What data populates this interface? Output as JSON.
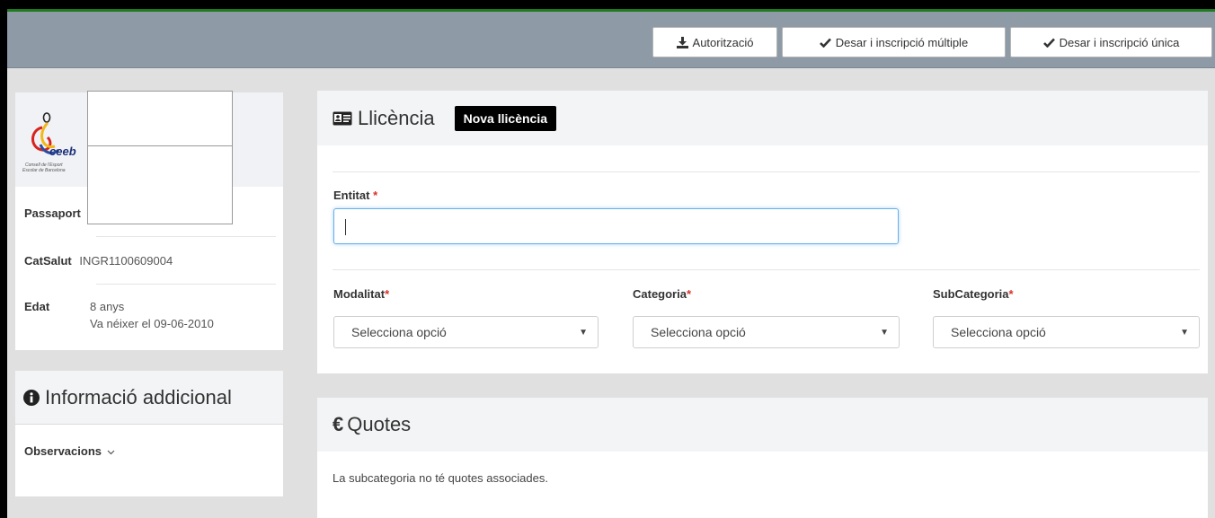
{
  "toolbar": {
    "authorization_label": "Autorització",
    "save_multiple_label": "Desar i inscripció múltiple",
    "save_single_label": "Desar i inscripció única"
  },
  "profile": {
    "logo_text": "ceeb",
    "logo_subtitle": "Consell de l'Esport Escolar de Barcelona",
    "passport_label": "Passaport",
    "catsalut_label": "CatSalut",
    "catsalut_value": "INGR1100609004",
    "age_label": "Edat",
    "age_value": "8 anys",
    "birth_text": "Va néixer el 09-06-2010"
  },
  "additional": {
    "title": "Informació addicional",
    "observations_label": "Observacions"
  },
  "license": {
    "title": "Llicència",
    "badge": "Nova llicència",
    "entity_label": "Entitat",
    "entity_value": "",
    "required_mark": "*",
    "modality_label": "Modalitat",
    "category_label": "Categoria",
    "subcategory_label": "SubCategoria",
    "select_placeholder": "Selecciona opció"
  },
  "fees": {
    "title": "Quotes",
    "currency_symbol": "€",
    "empty_message": "La subcategoria no té quotes associades."
  },
  "colors": {
    "required": "#d9312a",
    "topbar": "#8e9aa6",
    "badge_bg": "#000000",
    "focus_border": "#66afe9"
  }
}
